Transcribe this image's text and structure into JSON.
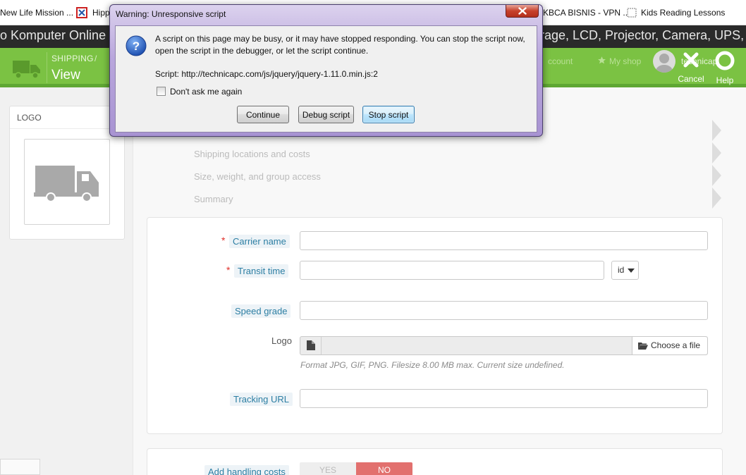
{
  "bookmarks": {
    "item1": "New Life Mission ...",
    "item2": "Hipp",
    "item3": "KBCA BISNIS - VPN ...",
    "item4": "Kids Reading Lessons"
  },
  "page_title": {
    "left": "o Komputer Online |",
    "right": "rage, LCD, Projector, Camera, UPS,"
  },
  "header": {
    "breadcrumb": "SHIPPING",
    "breadcrumb_sep": "/",
    "title": "View",
    "link_account": "ccount",
    "link_myshop": "My shop",
    "user_fragment": "technicap",
    "cancel_label": "Cancel",
    "help_label": "Help"
  },
  "sidebar": {
    "logo_heading": "LOGO"
  },
  "wizard_steps": [
    "Shipping locations and costs",
    "Size, weight, and group access",
    "Summary"
  ],
  "form": {
    "required_mark": "*",
    "carrier_name_label": "Carrier name",
    "carrier_name_value": "",
    "transit_time_label": "Transit time",
    "transit_time_value": "",
    "lang_select": "id",
    "speed_grade_label": "Speed grade",
    "speed_grade_value": "",
    "logo_label": "Logo",
    "choose_file_label": "Choose a file",
    "logo_help": "Format JPG, GIF, PNG. Filesize 8.00 MB max. Current size undefined.",
    "tracking_url_label": "Tracking URL",
    "tracking_url_value": "",
    "handling_costs_label": "Add handling costs",
    "toggle_yes": "YES",
    "toggle_no": "NO"
  },
  "dialog": {
    "title": "Warning: Unresponsive script",
    "message": "A script on this page may be busy, or it may have stopped responding. You can stop the script now, open the script in the debugger, or let the script continue.",
    "script_line": "Script: http://technicapc.com/js/jquery/jquery-1.11.0.min.js:2",
    "checkbox_label": "Don't ask me again",
    "continue_label": "Continue",
    "debug_label": "Debug script",
    "stop_label": "Stop script"
  },
  "colors": {
    "admin_green": "#7bc243",
    "label_blue": "#2c7ea3",
    "required_red": "#e0302a",
    "toggle_no_red": "#e2706e",
    "dialog_frame": "#b9a7dc"
  }
}
